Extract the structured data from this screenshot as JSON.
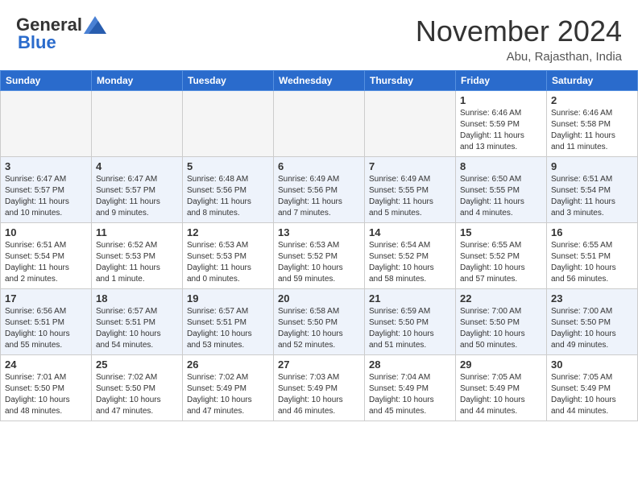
{
  "header": {
    "logo_general": "General",
    "logo_blue": "Blue",
    "month_title": "November 2024",
    "location": "Abu, Rajasthan, India"
  },
  "weekdays": [
    "Sunday",
    "Monday",
    "Tuesday",
    "Wednesday",
    "Thursday",
    "Friday",
    "Saturday"
  ],
  "weeks": [
    [
      {
        "day": "",
        "info": ""
      },
      {
        "day": "",
        "info": ""
      },
      {
        "day": "",
        "info": ""
      },
      {
        "day": "",
        "info": ""
      },
      {
        "day": "",
        "info": ""
      },
      {
        "day": "1",
        "info": "Sunrise: 6:46 AM\nSunset: 5:59 PM\nDaylight: 11 hours\nand 13 minutes."
      },
      {
        "day": "2",
        "info": "Sunrise: 6:46 AM\nSunset: 5:58 PM\nDaylight: 11 hours\nand 11 minutes."
      }
    ],
    [
      {
        "day": "3",
        "info": "Sunrise: 6:47 AM\nSunset: 5:57 PM\nDaylight: 11 hours\nand 10 minutes."
      },
      {
        "day": "4",
        "info": "Sunrise: 6:47 AM\nSunset: 5:57 PM\nDaylight: 11 hours\nand 9 minutes."
      },
      {
        "day": "5",
        "info": "Sunrise: 6:48 AM\nSunset: 5:56 PM\nDaylight: 11 hours\nand 8 minutes."
      },
      {
        "day": "6",
        "info": "Sunrise: 6:49 AM\nSunset: 5:56 PM\nDaylight: 11 hours\nand 7 minutes."
      },
      {
        "day": "7",
        "info": "Sunrise: 6:49 AM\nSunset: 5:55 PM\nDaylight: 11 hours\nand 5 minutes."
      },
      {
        "day": "8",
        "info": "Sunrise: 6:50 AM\nSunset: 5:55 PM\nDaylight: 11 hours\nand 4 minutes."
      },
      {
        "day": "9",
        "info": "Sunrise: 6:51 AM\nSunset: 5:54 PM\nDaylight: 11 hours\nand 3 minutes."
      }
    ],
    [
      {
        "day": "10",
        "info": "Sunrise: 6:51 AM\nSunset: 5:54 PM\nDaylight: 11 hours\nand 2 minutes."
      },
      {
        "day": "11",
        "info": "Sunrise: 6:52 AM\nSunset: 5:53 PM\nDaylight: 11 hours\nand 1 minute."
      },
      {
        "day": "12",
        "info": "Sunrise: 6:53 AM\nSunset: 5:53 PM\nDaylight: 11 hours\nand 0 minutes."
      },
      {
        "day": "13",
        "info": "Sunrise: 6:53 AM\nSunset: 5:52 PM\nDaylight: 10 hours\nand 59 minutes."
      },
      {
        "day": "14",
        "info": "Sunrise: 6:54 AM\nSunset: 5:52 PM\nDaylight: 10 hours\nand 58 minutes."
      },
      {
        "day": "15",
        "info": "Sunrise: 6:55 AM\nSunset: 5:52 PM\nDaylight: 10 hours\nand 57 minutes."
      },
      {
        "day": "16",
        "info": "Sunrise: 6:55 AM\nSunset: 5:51 PM\nDaylight: 10 hours\nand 56 minutes."
      }
    ],
    [
      {
        "day": "17",
        "info": "Sunrise: 6:56 AM\nSunset: 5:51 PM\nDaylight: 10 hours\nand 55 minutes."
      },
      {
        "day": "18",
        "info": "Sunrise: 6:57 AM\nSunset: 5:51 PM\nDaylight: 10 hours\nand 54 minutes."
      },
      {
        "day": "19",
        "info": "Sunrise: 6:57 AM\nSunset: 5:51 PM\nDaylight: 10 hours\nand 53 minutes."
      },
      {
        "day": "20",
        "info": "Sunrise: 6:58 AM\nSunset: 5:50 PM\nDaylight: 10 hours\nand 52 minutes."
      },
      {
        "day": "21",
        "info": "Sunrise: 6:59 AM\nSunset: 5:50 PM\nDaylight: 10 hours\nand 51 minutes."
      },
      {
        "day": "22",
        "info": "Sunrise: 7:00 AM\nSunset: 5:50 PM\nDaylight: 10 hours\nand 50 minutes."
      },
      {
        "day": "23",
        "info": "Sunrise: 7:00 AM\nSunset: 5:50 PM\nDaylight: 10 hours\nand 49 minutes."
      }
    ],
    [
      {
        "day": "24",
        "info": "Sunrise: 7:01 AM\nSunset: 5:50 PM\nDaylight: 10 hours\nand 48 minutes."
      },
      {
        "day": "25",
        "info": "Sunrise: 7:02 AM\nSunset: 5:50 PM\nDaylight: 10 hours\nand 47 minutes."
      },
      {
        "day": "26",
        "info": "Sunrise: 7:02 AM\nSunset: 5:49 PM\nDaylight: 10 hours\nand 47 minutes."
      },
      {
        "day": "27",
        "info": "Sunrise: 7:03 AM\nSunset: 5:49 PM\nDaylight: 10 hours\nand 46 minutes."
      },
      {
        "day": "28",
        "info": "Sunrise: 7:04 AM\nSunset: 5:49 PM\nDaylight: 10 hours\nand 45 minutes."
      },
      {
        "day": "29",
        "info": "Sunrise: 7:05 AM\nSunset: 5:49 PM\nDaylight: 10 hours\nand 44 minutes."
      },
      {
        "day": "30",
        "info": "Sunrise: 7:05 AM\nSunset: 5:49 PM\nDaylight: 10 hours\nand 44 minutes."
      }
    ]
  ]
}
